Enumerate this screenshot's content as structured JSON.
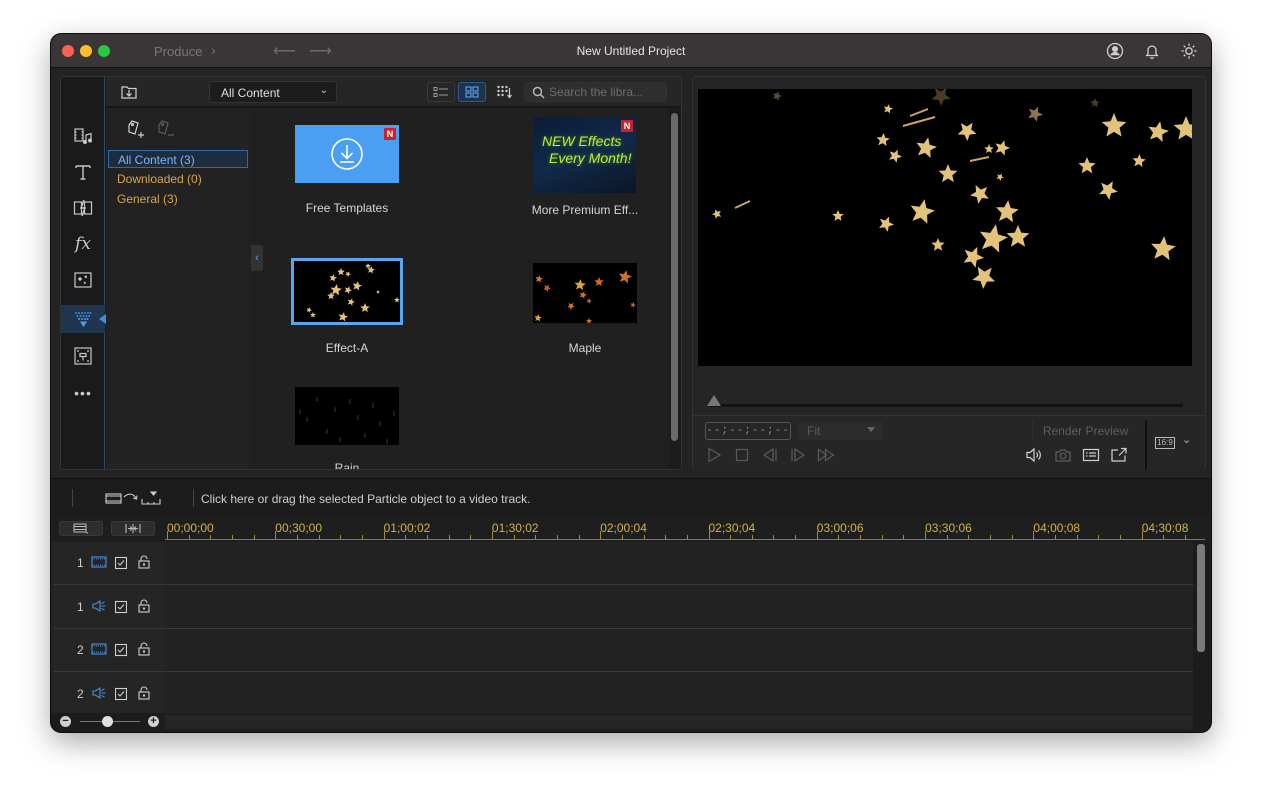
{
  "window": {
    "title": "New Untitled Project",
    "produce_label": "Produce",
    "nav": {
      "back_icon": "arrow-left",
      "forward_icon": "arrow-right"
    },
    "right_icons": [
      "account-icon",
      "notification-bell-icon",
      "settings-gear-icon"
    ]
  },
  "rooms": [
    {
      "name": "media-room",
      "icon": "film-music-icon"
    },
    {
      "name": "title-room",
      "icon": "text-T-icon"
    },
    {
      "name": "transition-room",
      "icon": "lightning-transition-icon"
    },
    {
      "name": "fx-room",
      "icon": "fx-icon"
    },
    {
      "name": "pip-room",
      "icon": "sparkle-frame-icon"
    },
    {
      "name": "particle-room",
      "icon": "particle-fountain-icon",
      "active": true
    },
    {
      "name": "subtitle-room",
      "icon": "subtitle-frame-icon"
    },
    {
      "name": "more-rooms",
      "icon": "more-dots-icon"
    }
  ],
  "library": {
    "filter_select": "All Content",
    "search_placeholder": "Search the libra...",
    "view_modes": [
      "details-view",
      "thumbnail-view",
      "sort"
    ],
    "active_view": "thumbnail-view",
    "tags": [
      {
        "label": "All Content (3)",
        "selected": true
      },
      {
        "label": "Downloaded (0)"
      },
      {
        "label": "General (3)"
      }
    ],
    "items": [
      {
        "label": "Free Templates",
        "badge": "N",
        "type": "download"
      },
      {
        "label": "More Premium Eff...",
        "badge": "N",
        "type": "promo",
        "promo_line1": "NEW Effects",
        "promo_line2": "Every Month!"
      },
      {
        "label": "Effect-A",
        "selected": true,
        "type": "stars"
      },
      {
        "label": "Maple",
        "type": "maple"
      },
      {
        "label": "Rain",
        "type": "rain"
      }
    ]
  },
  "preview": {
    "timecode": "--;--;--;--",
    "fit_select": "Fit",
    "render_preview_label": "Render Preview",
    "aspect_ratio": "16:9",
    "seek_position": 0
  },
  "timeline": {
    "hint": "Click here or drag the selected Particle object to a video track.",
    "ruler_labels": [
      "00;00;00",
      "00;30;00",
      "01;00;02",
      "01;30;02",
      "02;00;04",
      "02;30;04",
      "03;00;06",
      "03;30;06",
      "04;00;08",
      "04;30;08"
    ],
    "tracks": [
      {
        "number": "1",
        "type": "video"
      },
      {
        "number": "1",
        "type": "audio"
      },
      {
        "number": "2",
        "type": "video"
      },
      {
        "number": "2",
        "type": "audio"
      }
    ],
    "zoom_level": 0.45
  },
  "colors": {
    "accent_blue": "#4a9ff2",
    "selection_blue": "#5aa6ee",
    "tag_gold": "#d9a64a",
    "ruler_gold": "#d4b04a",
    "badge_red": "#c8232c",
    "star_gold": "#e3c27a"
  }
}
